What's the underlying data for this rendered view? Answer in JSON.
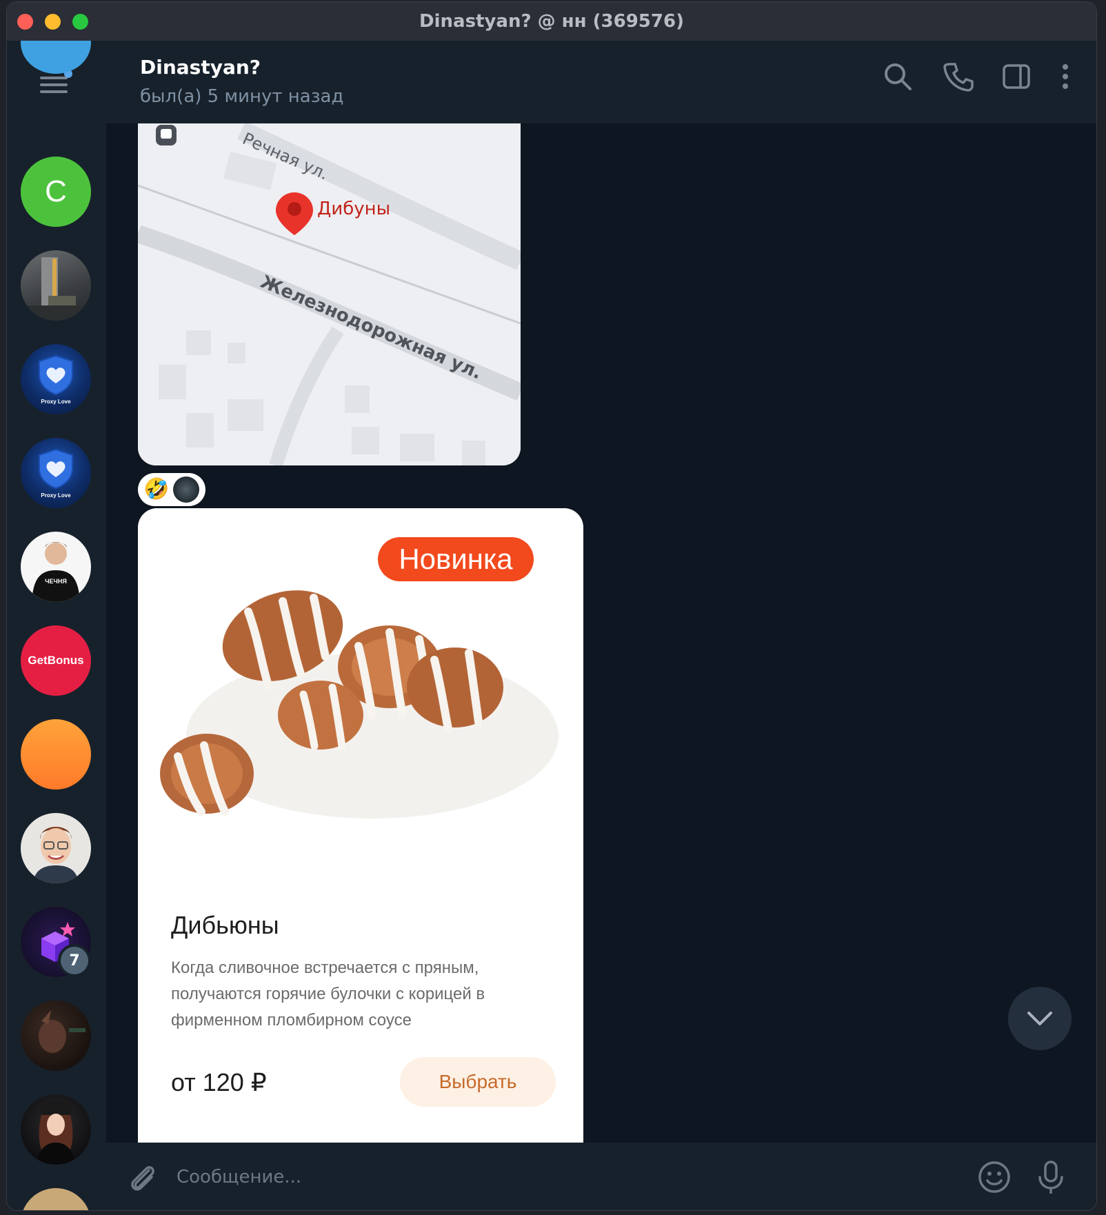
{
  "window": {
    "title": "Dinastyan? @ нн (369576)"
  },
  "sidebar": {
    "avatars": [
      {
        "letter": "C",
        "color": "#4cc23c"
      },
      {
        "proxy_label": "Proxy Love"
      },
      {
        "proxy_label": "Proxy Love"
      },
      {
        "shirt_text": "ЧЕЧНЯ"
      },
      {
        "text": "GetBonus",
        "color": "#e51f44"
      },
      {
        "unread_count": "7"
      }
    ]
  },
  "header": {
    "name": "Dinastyan?",
    "status": "был(а) 5 минут назад"
  },
  "map": {
    "street_top": "Речная ул.",
    "place": "Дибуны",
    "street_bottom": "Железнодорожная ул."
  },
  "reaction": {
    "emoji": "🤣"
  },
  "product_card": {
    "badge": "Новинка",
    "name": "Дибьюны",
    "description": "Когда сливочное встречается с пряным, получаются горячие булочки с корицей в фирменном пломбирном соусе",
    "price": "от 120 ₽",
    "button": "Выбрать"
  },
  "composer": {
    "placeholder": "Сообщение..."
  },
  "colors": {
    "accent": "#5aa7ea",
    "badge_orange": "#f2491d",
    "chat_bg": "#0e1621",
    "panel_bg": "#17212b"
  }
}
